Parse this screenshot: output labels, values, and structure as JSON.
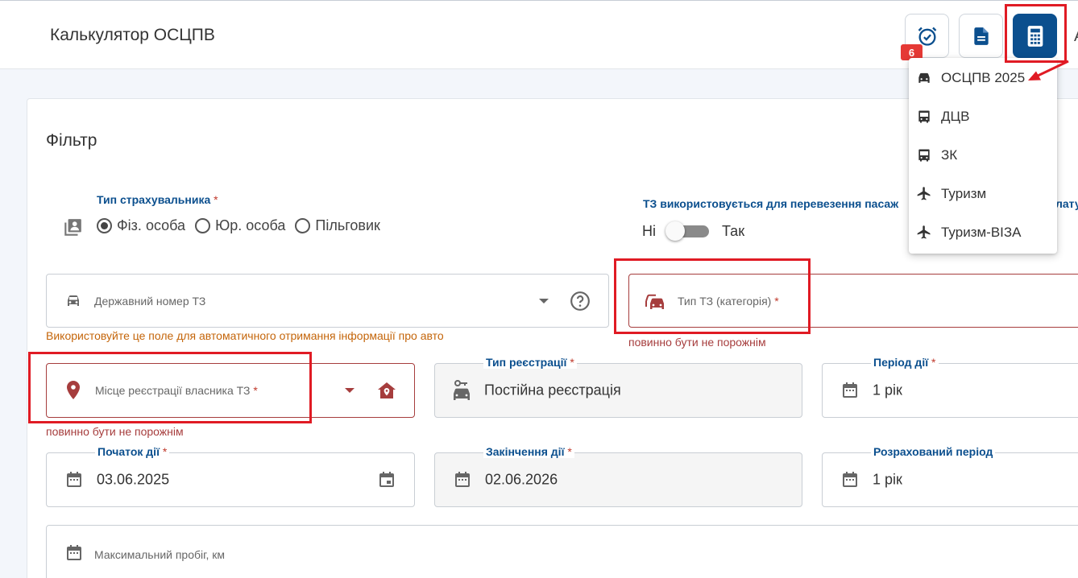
{
  "header": {
    "title": "Калькулятор ОСЦПВ",
    "badge_count": "6",
    "cut_char": "А"
  },
  "filter": {
    "title": "Фільтр",
    "insurer_type": {
      "label": "Тип страхувальника",
      "options": [
        "Фіз. особа",
        "Юр. особа",
        "Пільговик"
      ],
      "selected": "Фіз. особа"
    },
    "passenger": {
      "label": "ТЗ використовується для перевезення пасаж",
      "label_tail": "лату",
      "no": "Ні",
      "yes": "Так",
      "value": false
    },
    "plate": {
      "placeholder": "Державний номер ТЗ",
      "hint": "Використовуйте це поле для автоматичного отримання інформації про авто"
    },
    "vehicle_type": {
      "placeholder": "Тип ТЗ (категорія)",
      "error": "повинно бути не порожнім"
    },
    "owner_place": {
      "placeholder": "Місце реєстрації власника ТЗ",
      "error": "повинно бути не порожнім"
    },
    "registration_type": {
      "label": "Тип реєстрації",
      "value": "Постійна реєстрація"
    },
    "period": {
      "label": "Період дії",
      "value": "1 рік"
    },
    "start": {
      "label": "Початок дії",
      "value": "03.06.2025"
    },
    "end": {
      "label": "Закінчення дії",
      "value": "02.06.2026"
    },
    "calc_period": {
      "label": "Розрахований період",
      "value": "1 рік"
    },
    "mileage": {
      "placeholder": "Максимальний пробіг, км"
    },
    "required_mark": "*"
  },
  "menu": {
    "items": [
      {
        "label": "ОСЦПВ 2025",
        "icon": "car-icon"
      },
      {
        "label": "ДЦВ",
        "icon": "bus-icon"
      },
      {
        "label": "ЗК",
        "icon": "bus-icon"
      },
      {
        "label": "Туризм",
        "icon": "airplane-icon"
      },
      {
        "label": "Туризм-ВІЗА",
        "icon": "airplane-icon"
      }
    ]
  },
  "colors": {
    "accent": "#0b4f8e",
    "error": "#a63d3d",
    "hint": "#c4650a",
    "highlight": "#e01b24",
    "badge": "#e53935"
  }
}
